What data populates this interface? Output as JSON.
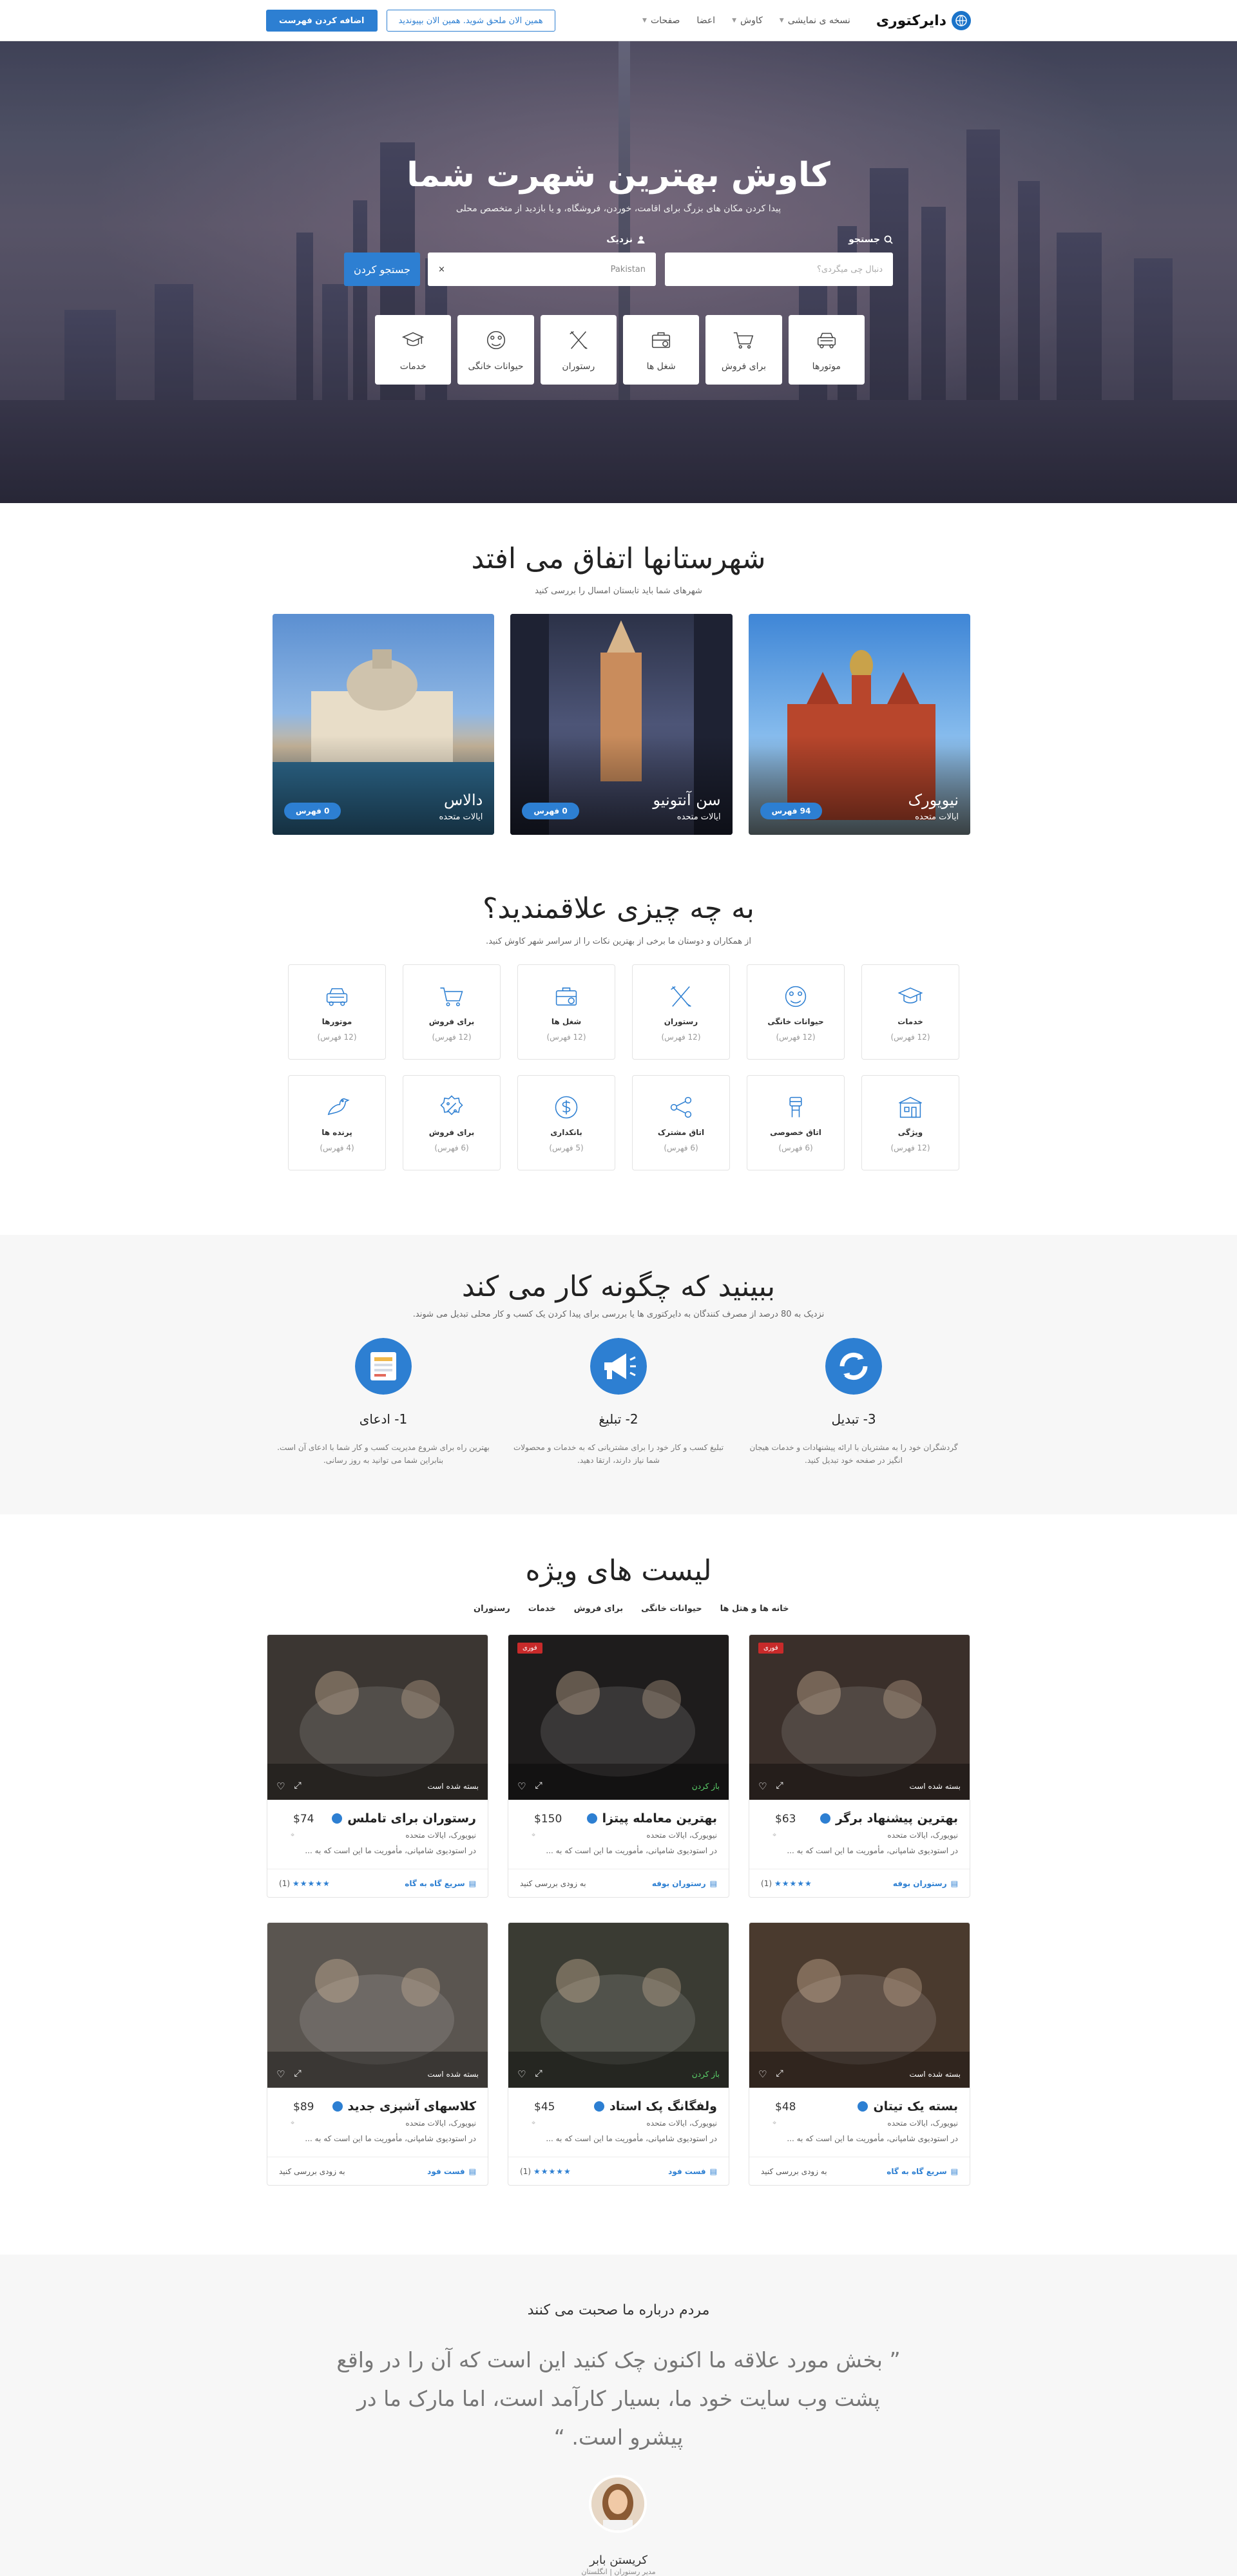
{
  "header": {
    "brand": "دایرکتوری",
    "nav": [
      "نسخه ی نمایشی",
      "کاوش",
      "اعضا",
      "صفحات"
    ],
    "join_label": "همین الان ملحق شوید. همین الان بپیوندید",
    "add_listing_label": "اضافه کردن فهرست"
  },
  "hero": {
    "title": "کاوش بهترین شهرت شما",
    "subtitle": "پیدا کردن مکان های بزرگ برای اقامت، خوردن، فروشگاه، و یا بازدید از متخصص محلی",
    "what_label": "جستجو",
    "what_placeholder": "دنبال چی میگردی؟",
    "where_label": "نزدیک",
    "where_value": "Pakistan",
    "search_button": "جستجو کردن",
    "categories": [
      {
        "label": "خدمات",
        "icon": "graduation-cap-icon"
      },
      {
        "label": "حیوانات خانگی",
        "icon": "pet-icon"
      },
      {
        "label": "رستوران",
        "icon": "utensils-icon"
      },
      {
        "label": "شغل ها",
        "icon": "briefcase-icon"
      },
      {
        "label": "برای فروش",
        "icon": "cart-icon"
      },
      {
        "label": "موتورها",
        "icon": "car-icon"
      }
    ]
  },
  "cities_section": {
    "title": "شهرستانها اتفاق می افتد",
    "subtitle": "شهرهای شما باید تابستان امسال را بررسی کنید",
    "cities": [
      {
        "name": "دالاس",
        "country": "ایالات متحده",
        "count": "0 فهرس"
      },
      {
        "name": "سن آنتونیو",
        "country": "ایالات متحده",
        "count": "0 فهرس"
      },
      {
        "name": "نیویورک",
        "country": "ایالات متحده",
        "count": "94 فهرس"
      }
    ]
  },
  "interests_section": {
    "title": "به چه چیزی علاقمندید؟",
    "subtitle": "از همکاران و دوستان ما برخی از بهترین نکات را از سراسر شهر کاوش کنید.",
    "items": [
      {
        "label": "خدمات",
        "count": "(12 فهرس)",
        "icon": "graduation-cap-icon"
      },
      {
        "label": "حیوانات خانگی",
        "count": "(12 فهرس)",
        "icon": "pet-icon"
      },
      {
        "label": "رستوران",
        "count": "(12 فهرس)",
        "icon": "utensils-icon"
      },
      {
        "label": "شغل ها",
        "count": "(12 فهرس)",
        "icon": "briefcase-icon"
      },
      {
        "label": "برای فروش",
        "count": "(12 فهرس)",
        "icon": "cart-icon"
      },
      {
        "label": "موتورها",
        "count": "(12 فهرس)",
        "icon": "car-icon"
      },
      {
        "label": "ویژگی",
        "count": "(12 فهرس)",
        "icon": "building-icon"
      },
      {
        "label": "اتاق خصوصی",
        "count": "(6 فهرس)",
        "icon": "bed-icon"
      },
      {
        "label": "اتاق مشترک",
        "count": "(6 فهرس)",
        "icon": "share-icon"
      },
      {
        "label": "بانکداری",
        "count": "(5 فهرس)",
        "icon": "dollar-icon"
      },
      {
        "label": "برای فروش",
        "count": "(6 فهرس)",
        "icon": "percent-icon"
      },
      {
        "label": "پرنده ها",
        "count": "(4 فهرس)",
        "icon": "bird-icon"
      }
    ]
  },
  "how_section": {
    "title": "ببینید که چگونه کار می کند",
    "subtitle": "نزدیک به 80 درصد از مصرف کنندگان به دایرکتوری ها یا بررسی برای پیدا کردن یک کسب و کار محلی تبدیل می شوند.",
    "steps": [
      {
        "title": "1- ادعای",
        "text": "بهترین راه برای شروع مدیریت کسب و کار شما با ادعای آن است. بنابراین شما می توانید به روز رسانی.",
        "icon": "claim-icon",
        "color": "#2d7fd2"
      },
      {
        "title": "2- تبلیغ",
        "text": "تبلیغ کسب و کار خود را برای مشتریانی که به خدمات و محصولات شما نیاز دارند، ارتقا دهید.",
        "icon": "megaphone-icon",
        "color": "#2d7fd2"
      },
      {
        "title": "3- تبدیل",
        "text": "گردشگران خود را به مشتریان با ارائه پیشنهادات و خدمات هیجان انگیز در صفحه خود تبدیل کنید.",
        "icon": "convert-icon",
        "color": "#2d7fd2"
      }
    ]
  },
  "featured_section": {
    "title": "لیست های ویژه",
    "tabs": [
      "رستوران",
      "خدمات",
      "برای فروش",
      "حیوانات خانگی",
      "خانه ها و هتل ها"
    ],
    "cards": [
      {
        "title": "بهترین پیشنهاد برگر",
        "price": "$63",
        "location": "نیویورک، ایالات متحده",
        "desc": "در استودیوی شامپانی، مأموریت ما این است که به ...",
        "status": "بسته شده است",
        "status_open": false,
        "ad": "فوری",
        "category": "رستوران بوفه",
        "rating": "(1)",
        "rated": true,
        "img": "#3a2f2a"
      },
      {
        "title": "بهترین معامله پیتزا",
        "price": "$150",
        "location": "نیویورک، ایالات متحده",
        "desc": "در استودیوی شامپانی، مأموریت ما این است که به ...",
        "status": "باز کردن",
        "status_open": true,
        "ad": "فوری",
        "category": "رستوران بوفه",
        "rating": "به زودی بررسی کنید",
        "rated": false,
        "img": "#1e1c1c"
      },
      {
        "title": "رستوران برای تاملس",
        "price": "$74",
        "location": "نیویورک، ایالات متحده",
        "desc": "در استودیوی شامپانی، مأموریت ما این است که به ...",
        "status": "بسته شده است",
        "status_open": false,
        "ad": "",
        "category": "سریع گاه به گاه",
        "rating": "(1)",
        "rated": true,
        "img": "#3b3632"
      },
      {
        "title": "بسته یک تیتان",
        "price": "$48",
        "location": "نیویورک، ایالات متحده",
        "desc": "در استودیوی شامپانی، مأموریت ما این است که به ...",
        "status": "بسته شده است",
        "status_open": false,
        "ad": "",
        "category": "سریع گاه به گاه",
        "rating": "به زودی بررسی کنید",
        "rated": false,
        "img": "#4a3a2e"
      },
      {
        "title": "ولفگانگ پک استاد",
        "price": "$45",
        "location": "نیویورک، ایالات متحده",
        "desc": "در استودیوی شامپانی، مأموریت ما این است که به ...",
        "status": "باز کردن",
        "status_open": true,
        "ad": "",
        "category": "فست فود",
        "rating": "(1)",
        "rated": true,
        "img": "#3a3b33"
      },
      {
        "title": "کلاسهای آشپزی جدید",
        "price": "$89",
        "location": "نیویورک، ایالات متحده",
        "desc": "در استودیوی شامپانی، مأموریت ما این است که به ...",
        "status": "بسته شده است",
        "status_open": false,
        "ad": "",
        "category": "فست فود",
        "rating": "به زودی بررسی کنید",
        "rated": false,
        "img": "#5a5550"
      }
    ]
  },
  "testimonials": {
    "title": "مردم درباره ما صحبت می کنند",
    "quote": "بخش مورد علاقه ما اکنون چک کنید این است که آن را در واقع پشت وب سایت خود ما، بسیار کارآمد است، اما مارک ما در پیشرو است.",
    "name": "کریستن بابر",
    "role": "مدیر رستوران | انگلستان"
  }
}
